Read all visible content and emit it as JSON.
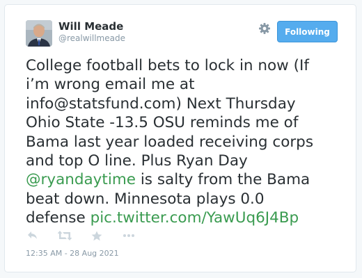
{
  "user": {
    "name": "Will Meade",
    "handle": "@realwillmeade"
  },
  "follow_button": {
    "label": "Following"
  },
  "tweet": {
    "lines": [
      [
        {
          "text": "College football bets to lock in now (If",
          "link": false
        }
      ],
      [
        {
          "text": "i’m wrong email me at",
          "link": false
        }
      ],
      [
        {
          "text": "info@statsfund.com) Next Thursday",
          "link": false
        }
      ],
      [
        {
          "text": "Ohio State -13.5 OSU reminds me of",
          "link": false
        }
      ],
      [
        {
          "text": "Bama last year loaded receiving corps",
          "link": false
        }
      ],
      [
        {
          "text": "and top O line. Plus Ryan Day",
          "link": false
        }
      ],
      [
        {
          "text": "@ryandaytime",
          "link": true
        },
        {
          "text": " is salty from the Bama",
          "link": false
        }
      ],
      [
        {
          "text": "beat down. Minnesota plays 0.0",
          "link": false
        }
      ],
      [
        {
          "text": "defense ",
          "link": false
        },
        {
          "text": "pic.twitter.com/YawUq6J4Bp",
          "link": true
        }
      ]
    ]
  },
  "actions": [
    {
      "name": "reply-icon"
    },
    {
      "name": "retweet-icon"
    },
    {
      "name": "favorite-icon"
    },
    {
      "name": "more-icon"
    }
  ],
  "timestamp": "12:35 AM - 28 Aug 2021",
  "colors": {
    "accent": "#55acee",
    "link": "#3a9b50",
    "text": "#292f33",
    "muted": "#8899a6"
  }
}
